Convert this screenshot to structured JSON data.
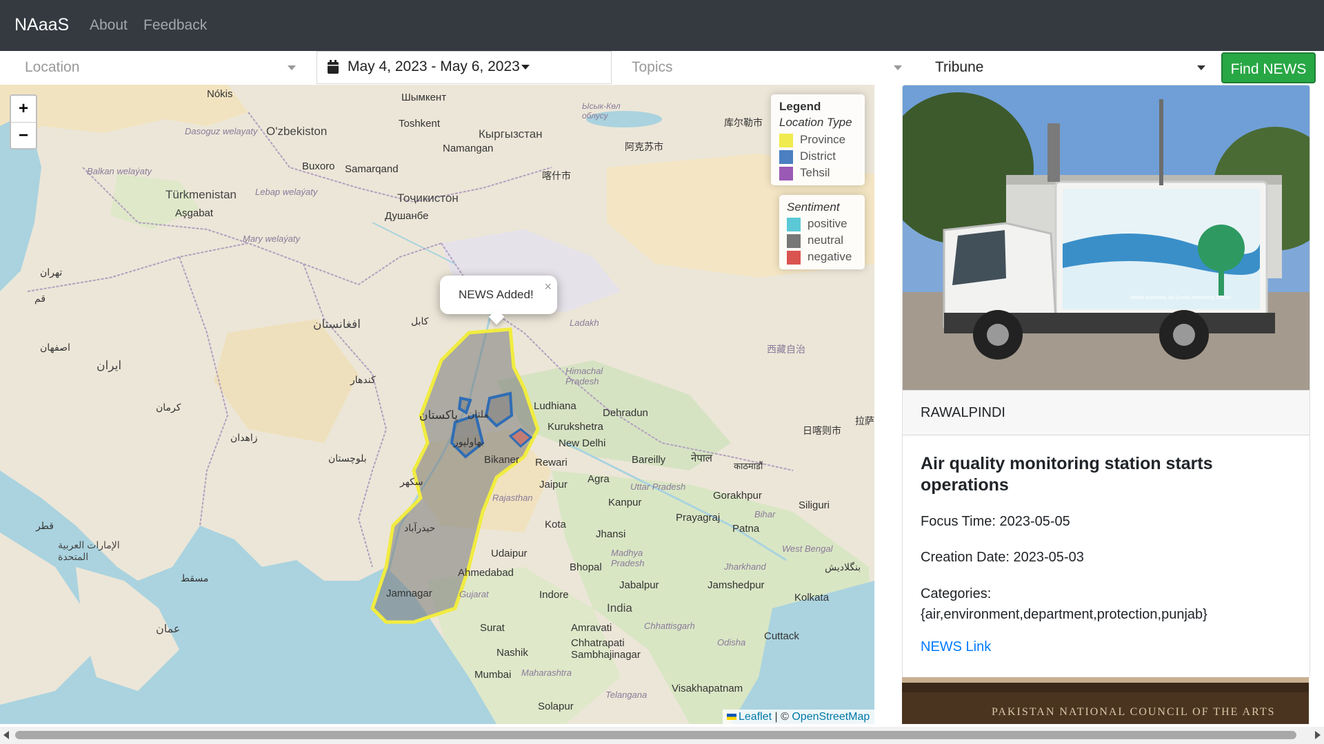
{
  "navbar": {
    "brand": "NAaaS",
    "links": [
      "About",
      "Feedback"
    ]
  },
  "filters": {
    "location_placeholder": "Location",
    "date_range": "May 4, 2023 - May 6, 2023",
    "topics_placeholder": "Topics",
    "source": "Tribune",
    "find_button": "Find NEWS"
  },
  "map": {
    "zoom_in": "+",
    "zoom_out": "−",
    "popup_text": "NEWS Added!",
    "popup_close": "×",
    "legend_location": {
      "title": "Legend",
      "subtitle": "Location Type",
      "items": [
        {
          "label": "Province",
          "color": "#f0eb4e"
        },
        {
          "label": "District",
          "color": "#4a7fc1"
        },
        {
          "label": "Tehsil",
          "color": "#9a59b5"
        }
      ]
    },
    "legend_sentiment": {
      "subtitle": "Sentiment",
      "items": [
        {
          "label": "positive",
          "color": "#5bc8d6"
        },
        {
          "label": "neutral",
          "color": "#777777"
        },
        {
          "label": "negative",
          "color": "#d9534f"
        }
      ]
    },
    "attribution": {
      "leaflet": "Leaflet",
      "separator": "| ©",
      "osm": "OpenStreetMap"
    },
    "labels": [
      {
        "text": "Nókis"
      },
      {
        "text": "Шымкент"
      },
      {
        "text": "Toshkent"
      },
      {
        "text": "O'zbekiston"
      },
      {
        "text": "Dasoguz welayaty"
      },
      {
        "text": "Кыргызстан"
      },
      {
        "text": "Namangan"
      },
      {
        "text": "Buxoro"
      },
      {
        "text": "Samarqand"
      },
      {
        "text": "Türkmenistan"
      },
      {
        "text": "Lebap welaýaty"
      },
      {
        "text": "Balkan welaýaty"
      },
      {
        "text": "Aşgabat"
      },
      {
        "text": "Mary welaýaty"
      },
      {
        "text": "Тоҷикистон"
      },
      {
        "text": "Душанбе"
      },
      {
        "text": "库尔勒市"
      },
      {
        "text": "阿克苏市"
      },
      {
        "text": "喀什市"
      },
      {
        "text": "Ысык-Көл облусу"
      },
      {
        "text": "افغانستان"
      },
      {
        "text": "ایران"
      },
      {
        "text": "کابل"
      },
      {
        "text": "کندهار"
      },
      {
        "text": "پاکستان"
      },
      {
        "text": "ملتان"
      },
      {
        "text": "بهاولپور"
      },
      {
        "text": "سکهر"
      },
      {
        "text": "حیدرآباد"
      },
      {
        "text": "Ladakh"
      },
      {
        "text": "Himachal Pradesh"
      },
      {
        "text": "西藏自治"
      },
      {
        "text": "Ludhiana"
      },
      {
        "text": "Dehradun"
      },
      {
        "text": "Kurukshetra"
      },
      {
        "text": "New Delhi"
      },
      {
        "text": "Bikaner"
      },
      {
        "text": "Rewari"
      },
      {
        "text": "Bareilly"
      },
      {
        "text": "नेपाल"
      },
      {
        "text": "काठमाडौं"
      },
      {
        "text": "Jaipur"
      },
      {
        "text": "Agra"
      },
      {
        "text": "Uttar Pradesh"
      },
      {
        "text": "Rajasthan"
      },
      {
        "text": "Kanpur"
      },
      {
        "text": "Gorakhpur"
      },
      {
        "text": "Siliguri"
      },
      {
        "text": "Prayagraj"
      },
      {
        "text": "Bihar"
      },
      {
        "text": "Kota"
      },
      {
        "text": "Jhansi"
      },
      {
        "text": "Patna"
      },
      {
        "text": "Udaipur"
      },
      {
        "text": "Madhya Pradesh"
      },
      {
        "text": "West Bengal"
      },
      {
        "text": "Jharkhand"
      },
      {
        "text": "Ahmedabad"
      },
      {
        "text": "Bhopal"
      },
      {
        "text": "Jabalpur"
      },
      {
        "text": "Jamshedpur"
      },
      {
        "text": "Jamnagar"
      },
      {
        "text": "Gujarat"
      },
      {
        "text": "Indore"
      },
      {
        "text": "India"
      },
      {
        "text": "Kolkata"
      },
      {
        "text": "Chhattisgarh"
      },
      {
        "text": "Surat"
      },
      {
        "text": "Amravati"
      },
      {
        "text": "Cuttack"
      },
      {
        "text": "Odisha"
      },
      {
        "text": "Chhatrapati Sambhajinagar"
      },
      {
        "text": "Nashik"
      },
      {
        "text": "Maharashtra"
      },
      {
        "text": "Mumbai"
      },
      {
        "text": "Telangana"
      },
      {
        "text": "Visakhapatnam"
      },
      {
        "text": "Solapur"
      },
      {
        "text": "日喀则市"
      },
      {
        "text": "拉萨"
      },
      {
        "text": "بنگلادیش"
      },
      {
        "text": "عمان"
      },
      {
        "text": "مسقط"
      },
      {
        "text": "الإمارات العربية المتحدة"
      },
      {
        "text": "قطر"
      },
      {
        "text": "کرمان"
      },
      {
        "text": "زاهدان"
      },
      {
        "text": "بلوچستان"
      },
      {
        "text": "تهران"
      },
      {
        "text": "اصفهان"
      },
      {
        "text": "قم"
      }
    ]
  },
  "news_card": {
    "location": "RAWALPINDI",
    "title": "Air quality monitoring station starts operations",
    "focus_time": "Focus Time: 2023-05-05",
    "creation_date": "Creation Date: 2023-05-03",
    "categories_label": "Categories:",
    "categories": "{air,environment,department,protection,punjab}",
    "link_text": "NEWS Link",
    "image_caption": "Mobile Automatic Air Quality Monitoring Station"
  },
  "news_card_2": {
    "image_text": "PAKISTAN NATIONAL COUNCIL OF THE ARTS"
  }
}
